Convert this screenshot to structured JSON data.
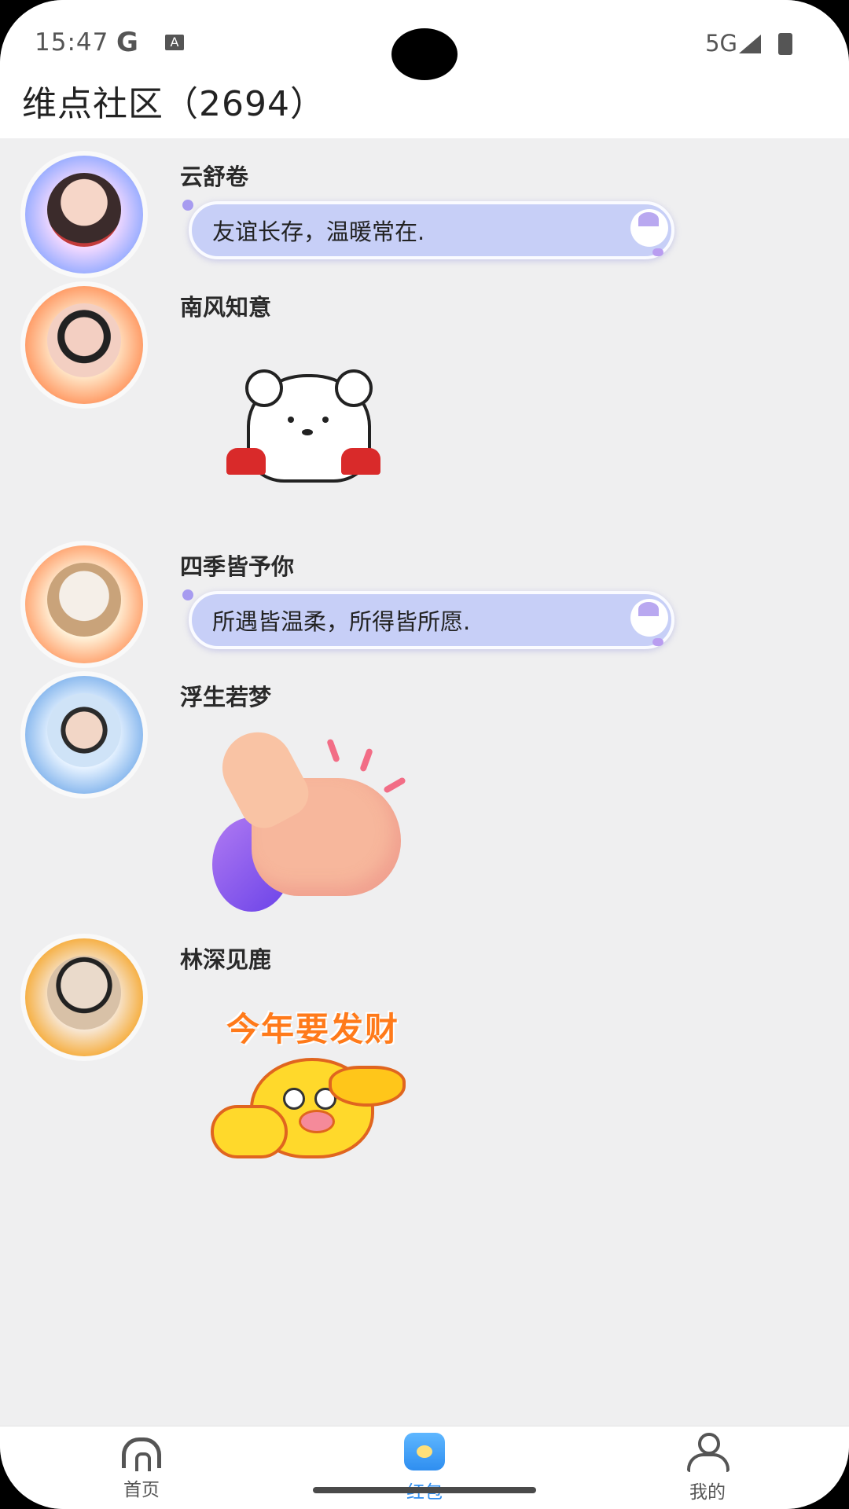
{
  "status_bar": {
    "time": "15:47",
    "google_icon": "G",
    "notif_icon": "A",
    "network": "5G"
  },
  "header": {
    "title": "维点社区（2694）"
  },
  "messages": [
    {
      "sender": "云舒卷",
      "type": "text",
      "text": "友谊长存，温暖常在.",
      "avatar_icon": "avatar-girl-icon"
    },
    {
      "sender": "南风知意",
      "type": "sticker",
      "sticker_icon": "bear-sticker-icon",
      "avatar_icon": "avatar-sunglasses-icon"
    },
    {
      "sender": "四季皆予你",
      "type": "text",
      "text": "所遇皆温柔，所得皆所愿.",
      "avatar_icon": "avatar-dog-cat-icon"
    },
    {
      "sender": "浮生若梦",
      "type": "sticker",
      "sticker_icon": "thumbs-up-sticker-icon",
      "avatar_icon": "avatar-child-icon"
    },
    {
      "sender": "林深见鹿",
      "type": "sticker",
      "sticker_text": "今年要发财",
      "sticker_icon": "chick-sticker-icon",
      "avatar_icon": "avatar-sheep-icon"
    }
  ],
  "nav": {
    "home": "首页",
    "redpack": "红包",
    "me": "我的",
    "active": "redpack",
    "accent_color": "#2f8ef0"
  }
}
